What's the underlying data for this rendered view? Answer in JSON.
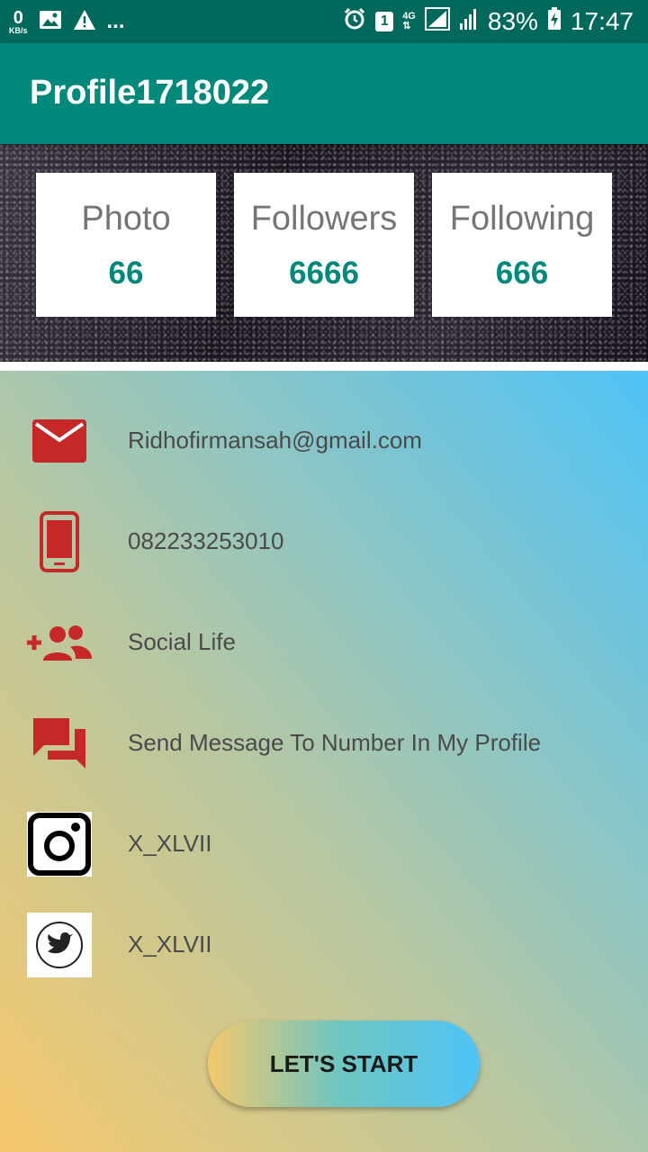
{
  "status_bar": {
    "net_speed": "0",
    "net_unit": "KB/s",
    "ellipsis": "...",
    "sim_slot": "1",
    "network": "4G",
    "battery": "83%",
    "time": "17:47"
  },
  "app_bar": {
    "title": "Profile1718022",
    "color": "#00897b"
  },
  "stats": [
    {
      "label": "Photo",
      "value": "66"
    },
    {
      "label": "Followers",
      "value": "6666"
    },
    {
      "label": "Following",
      "value": "666"
    }
  ],
  "contacts": [
    {
      "icon": "email-icon",
      "text": "Ridhofirmansah@gmail.com"
    },
    {
      "icon": "phone-icon",
      "text": "082233253010"
    },
    {
      "icon": "add-group-icon",
      "text": "Social Life"
    },
    {
      "icon": "message-icon",
      "text": "Send Message To Number In My Profile"
    },
    {
      "icon": "instagram-icon",
      "text": "X_XLVII"
    },
    {
      "icon": "twitter-icon",
      "text": "X_XLVII"
    }
  ],
  "button": {
    "label": "LET'S START"
  },
  "colors": {
    "accent": "#00897b",
    "icon_red": "#c62828",
    "gradient_start": "#f7c86c",
    "gradient_end": "#4fc3f7"
  }
}
